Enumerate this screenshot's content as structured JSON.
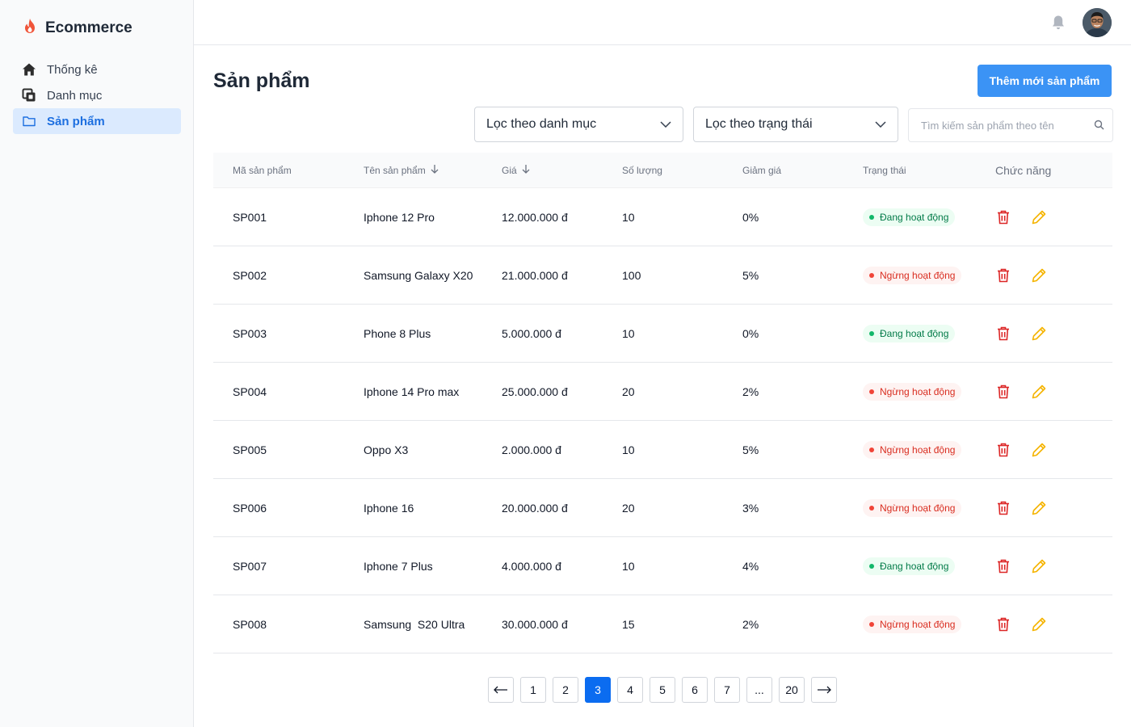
{
  "app": {
    "title": "Ecommerce"
  },
  "sidebar": {
    "items": [
      {
        "label": "Thống kê",
        "icon": "home-icon",
        "active": false
      },
      {
        "label": "Danh mục",
        "icon": "category-icon",
        "active": false
      },
      {
        "label": "Sản phẩm",
        "icon": "folder-icon",
        "active": true
      }
    ]
  },
  "header": {
    "notification_icon": "bell-icon",
    "avatar": "user-avatar"
  },
  "main": {
    "title": "Sản phẩm",
    "add_button": "Thêm mới sản phẩm",
    "filters": {
      "category": "Lọc theo danh mục",
      "status": "Lọc theo trạng thái"
    },
    "search": {
      "placeholder": "Tìm kiếm sản phẩm theo tên",
      "value": ""
    }
  },
  "table": {
    "headers": [
      "Mã sản phẩm",
      "Tên sản phẩm",
      "Giá",
      "Số lượng",
      "Giảm giá",
      "Trạng thái",
      "Chức năng"
    ],
    "rows": [
      {
        "code": "SP001",
        "name": "Iphone 12 Pro",
        "price": "12.000.000 đ",
        "qty": "10",
        "discount": "0%",
        "status": "Đang hoạt động",
        "active": true
      },
      {
        "code": "SP002",
        "name": "Samsung Galaxy X20",
        "price": "21.000.000 đ",
        "qty": "100",
        "discount": "5%",
        "status": "Ngừng hoạt động",
        "active": false
      },
      {
        "code": "SP003",
        "name": "Phone 8 Plus",
        "price": "5.000.000 đ",
        "qty": "10",
        "discount": "0%",
        "status": "Đang hoạt động",
        "active": true
      },
      {
        "code": "SP004",
        "name": "Iphone 14 Pro max",
        "price": "25.000.000 đ",
        "qty": "20",
        "discount": "2%",
        "status": "Ngừng hoạt động",
        "active": false
      },
      {
        "code": "SP005",
        "name": "Oppo X3",
        "price": "2.000.000 đ",
        "qty": "10",
        "discount": "5%",
        "status": "Ngừng hoạt động",
        "active": false
      },
      {
        "code": "SP006",
        "name": "Iphone 16",
        "price": "20.000.000 đ",
        "qty": "20",
        "discount": "3%",
        "status": "Ngừng hoạt động",
        "active": false
      },
      {
        "code": "SP007",
        "name": "Iphone 7 Plus",
        "price": "4.000.000 đ",
        "qty": "10",
        "discount": "4%",
        "status": "Đang hoạt động",
        "active": true
      },
      {
        "code": "SP008",
        "name": "Samsung  S20 Ultra",
        "price": "30.000.000 đ",
        "qty": "15",
        "discount": "2%",
        "status": "Ngừng hoạt động",
        "active": false
      }
    ]
  },
  "pagination": {
    "pages": [
      "1",
      "2",
      "3",
      "4",
      "5",
      "6",
      "7",
      "...",
      "20"
    ],
    "current": "3"
  },
  "colors": {
    "primary": "#3b93f5",
    "active_page": "#0b6cf0",
    "status_on": "#027a48",
    "status_off": "#d92d20",
    "delete_icon": "#dc2626",
    "edit_icon": "#f5b400",
    "brand_icon": "#f0553a"
  }
}
